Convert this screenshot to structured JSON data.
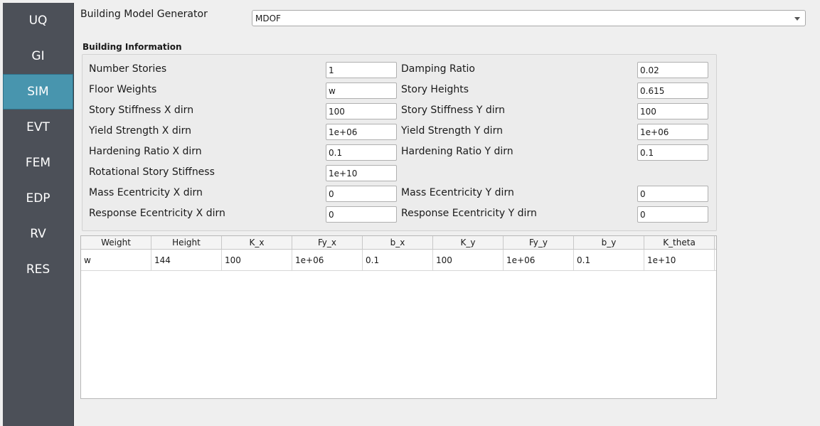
{
  "sidebar": {
    "items": [
      {
        "label": "UQ"
      },
      {
        "label": "GI"
      },
      {
        "label": "SIM",
        "active": true
      },
      {
        "label": "EVT"
      },
      {
        "label": "FEM"
      },
      {
        "label": "EDP"
      },
      {
        "label": "RV"
      },
      {
        "label": "RES"
      }
    ]
  },
  "generator": {
    "label": "Building Model Generator",
    "value": "MDOF"
  },
  "building_info": {
    "title": "Building Information",
    "number_stories": {
      "label": "Number Stories",
      "value": "1"
    },
    "damping_ratio": {
      "label": "Damping Ratio",
      "value": "0.02"
    },
    "floor_weights": {
      "label": "Floor Weights",
      "value": "w"
    },
    "story_heights": {
      "label": "Story Heights",
      "value": "0.615"
    },
    "stiffness_x": {
      "label": "Story Stiffness X dirn",
      "value": "100"
    },
    "stiffness_y": {
      "label": "Story Stiffness Y dirn",
      "value": "100"
    },
    "yield_x": {
      "label": "Yield Strength X dirn",
      "value": "1e+06"
    },
    "yield_y": {
      "label": "Yield Strength Y dirn",
      "value": "1e+06"
    },
    "hardening_x": {
      "label": "Hardening Ratio X dirn",
      "value": "0.1"
    },
    "hardening_y": {
      "label": "Hardening Ratio Y dirn",
      "value": "0.1"
    },
    "rotational": {
      "label": "Rotational Story Stiffness",
      "value": "1e+10"
    },
    "mass_ecc_x": {
      "label": "Mass Ecentricity X dirn",
      "value": "0"
    },
    "mass_ecc_y": {
      "label": "Mass Ecentricity Y dirn",
      "value": "0"
    },
    "resp_ecc_x": {
      "label": "Response Ecentricity X dirn",
      "value": "0"
    },
    "resp_ecc_y": {
      "label": "Response Ecentricity Y dirn",
      "value": "0"
    }
  },
  "table": {
    "headers": [
      "Weight",
      "Height",
      "K_x",
      "Fy_x",
      "b_x",
      "K_y",
      "Fy_y",
      "b_y",
      "K_theta"
    ],
    "rows": [
      [
        "w",
        "144",
        "100",
        "1e+06",
        "0.1",
        "100",
        "1e+06",
        "0.1",
        "1e+10"
      ]
    ]
  }
}
